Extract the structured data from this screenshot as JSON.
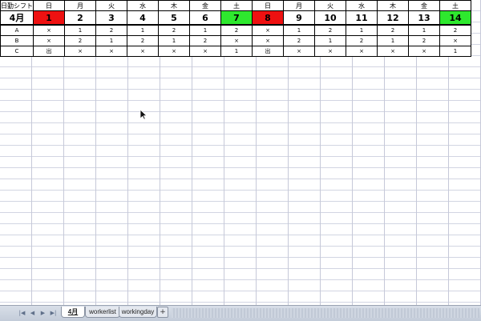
{
  "table": {
    "header_label": "日勤シフト",
    "month_label": "4月",
    "weekdays": [
      "日",
      "月",
      "火",
      "水",
      "木",
      "金",
      "土",
      "日",
      "月",
      "火",
      "水",
      "木",
      "金",
      "土"
    ],
    "dates": [
      "1",
      "2",
      "3",
      "4",
      "5",
      "6",
      "7",
      "8",
      "9",
      "10",
      "11",
      "12",
      "13",
      "14"
    ],
    "date_colors": [
      "#ee1111",
      "",
      "",
      "",
      "",
      "",
      "#2ee82e",
      "#ee1111",
      "",
      "",
      "",
      "",
      "",
      "#2ee82e"
    ],
    "workers": [
      {
        "name": "A",
        "shifts": [
          "×",
          "1",
          "2",
          "1",
          "2",
          "1",
          "2",
          "×",
          "1",
          "2",
          "1",
          "2",
          "1",
          "2"
        ]
      },
      {
        "name": "B",
        "shifts": [
          "×",
          "2",
          "1",
          "2",
          "1",
          "2",
          "×",
          "×",
          "2",
          "1",
          "2",
          "1",
          "2",
          "×"
        ]
      },
      {
        "name": "C",
        "shifts": [
          "出",
          "×",
          "×",
          "×",
          "×",
          "×",
          "1",
          "出",
          "×",
          "×",
          "×",
          "×",
          "×",
          "1"
        ]
      }
    ]
  },
  "sheet_tabs": [
    "4月",
    "workerlist",
    "workingday"
  ],
  "active_tab": "4月",
  "add_tab_label": "+",
  "nav_buttons": [
    "|◀",
    "◀",
    "▶",
    "▶|"
  ],
  "cursor_icon": "arrow-cursor-icon"
}
